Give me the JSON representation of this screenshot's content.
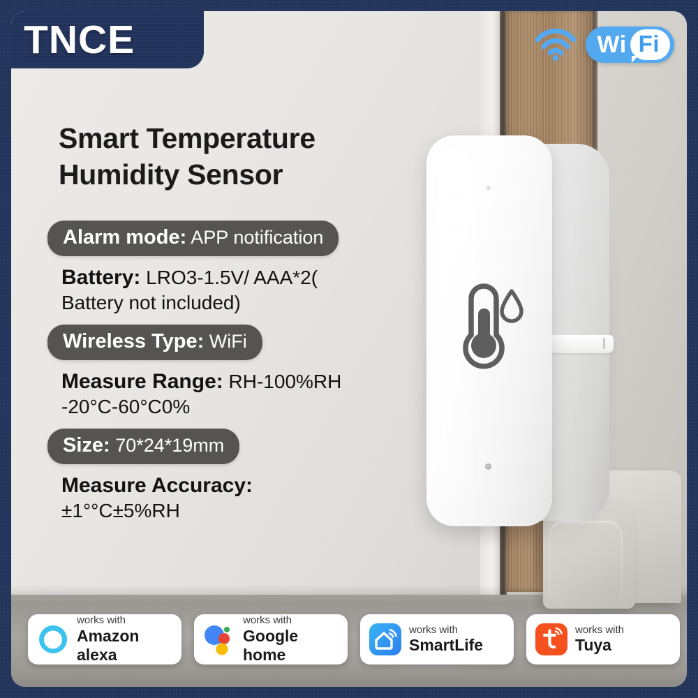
{
  "brand": {
    "logo_text": "TNCE"
  },
  "header": {
    "wifi_icon": "wifi-signal-icon",
    "wifi_badge": {
      "part1": "Wi",
      "part2": "Fi"
    }
  },
  "headline": {
    "line1": "Smart Temperature",
    "line2": "Humidity Sensor"
  },
  "specs": [
    {
      "style": "pill",
      "key": "Alarm mode:",
      "value": "APP notification",
      "line2": ""
    },
    {
      "style": "plain",
      "key": "Battery:",
      "value": "LRO3-1.5V/ AAA*2(",
      "line2": "Battery not included)"
    },
    {
      "style": "pill",
      "key": "Wireless Type:",
      "value": "WiFi",
      "line2": ""
    },
    {
      "style": "plain",
      "key": "Measure Range:",
      "value": "RH-100%RH",
      "line2": "-20°C-60°C0%"
    },
    {
      "style": "pill",
      "key": "Size:",
      "value": "70*24*19mm",
      "line2": ""
    },
    {
      "style": "plain",
      "key": "Measure Accuracy:",
      "value": "",
      "line2": "±1°°C±5%RH"
    }
  ],
  "device": {
    "name": "smart-temperature-humidity-sensor",
    "icons": [
      "thermometer-icon",
      "water-drop-icon"
    ],
    "led": "status-led-indicator"
  },
  "badges": [
    {
      "logo": "amazon-alexa-icon",
      "small": "works with",
      "large": "Amazon alexa",
      "color": "#3ec3ef"
    },
    {
      "logo": "google-assistant-icon",
      "small": "works with",
      "large": "Google home",
      "color": "#4285f4"
    },
    {
      "logo": "smartlife-icon",
      "small": "works with",
      "large": "SmartLife",
      "color": "#36a9f2"
    },
    {
      "logo": "tuya-icon",
      "small": "works with",
      "large": "Tuya",
      "color": "#f4511e"
    }
  ],
  "colors": {
    "frame_navy": "#22335c",
    "pill_gray": "#565451",
    "wifi_blue": "#53a9f0",
    "wall": "#e9e7e4",
    "wood": "#a3825f"
  }
}
